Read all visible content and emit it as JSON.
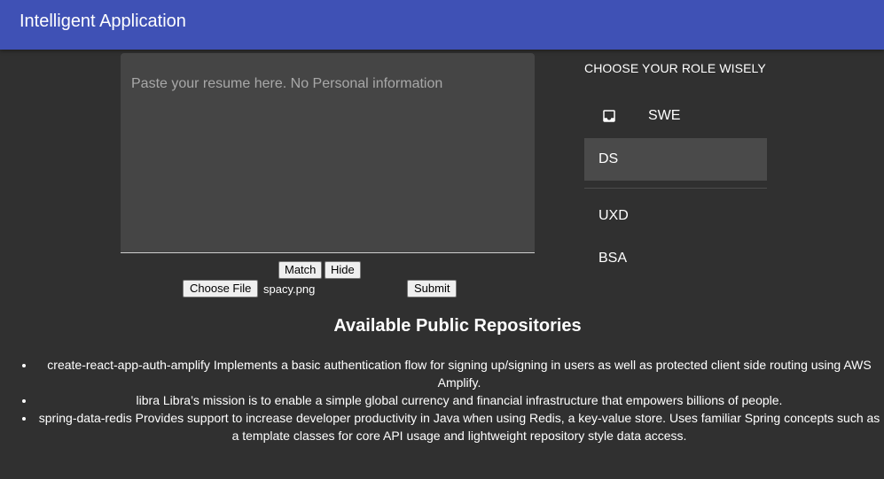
{
  "app": {
    "title": "Intelligent Application"
  },
  "resume": {
    "placeholder": "Paste your resume here. No Personal information"
  },
  "actions": {
    "match_label": "Match",
    "hide_label": "Hide",
    "choose_file_label": "Choose File",
    "file_name": "spacy.png",
    "submit_label": "Submit"
  },
  "roles": {
    "header": "CHOOSE YOUR ROLE WISELY",
    "items": [
      {
        "label": "SWE",
        "icon": "inbox-icon"
      },
      {
        "label": "DS",
        "selected": true
      },
      {
        "label": "UXD"
      },
      {
        "label": "BSA"
      }
    ]
  },
  "repos": {
    "heading": "Available Public Repositories",
    "items": [
      {
        "text": "create-react-app-auth-amplify Implements a basic authentication flow for signing up/signing in users as well as protected client side routing using AWS Amplify."
      },
      {
        "text": "libra Libra’s mission is to enable a simple global currency and financial infrastructure that empowers billions of people."
      },
      {
        "text": "spring-data-redis Provides support to increase developer productivity in Java when using Redis, a key-value store. Uses familiar Spring concepts such as a template classes for core API usage and lightweight repository style data access."
      }
    ]
  },
  "colors": {
    "appbar": "#3f51b5",
    "background": "#303030",
    "input_background": "#454545",
    "selected_role": "#4a4a4a"
  }
}
